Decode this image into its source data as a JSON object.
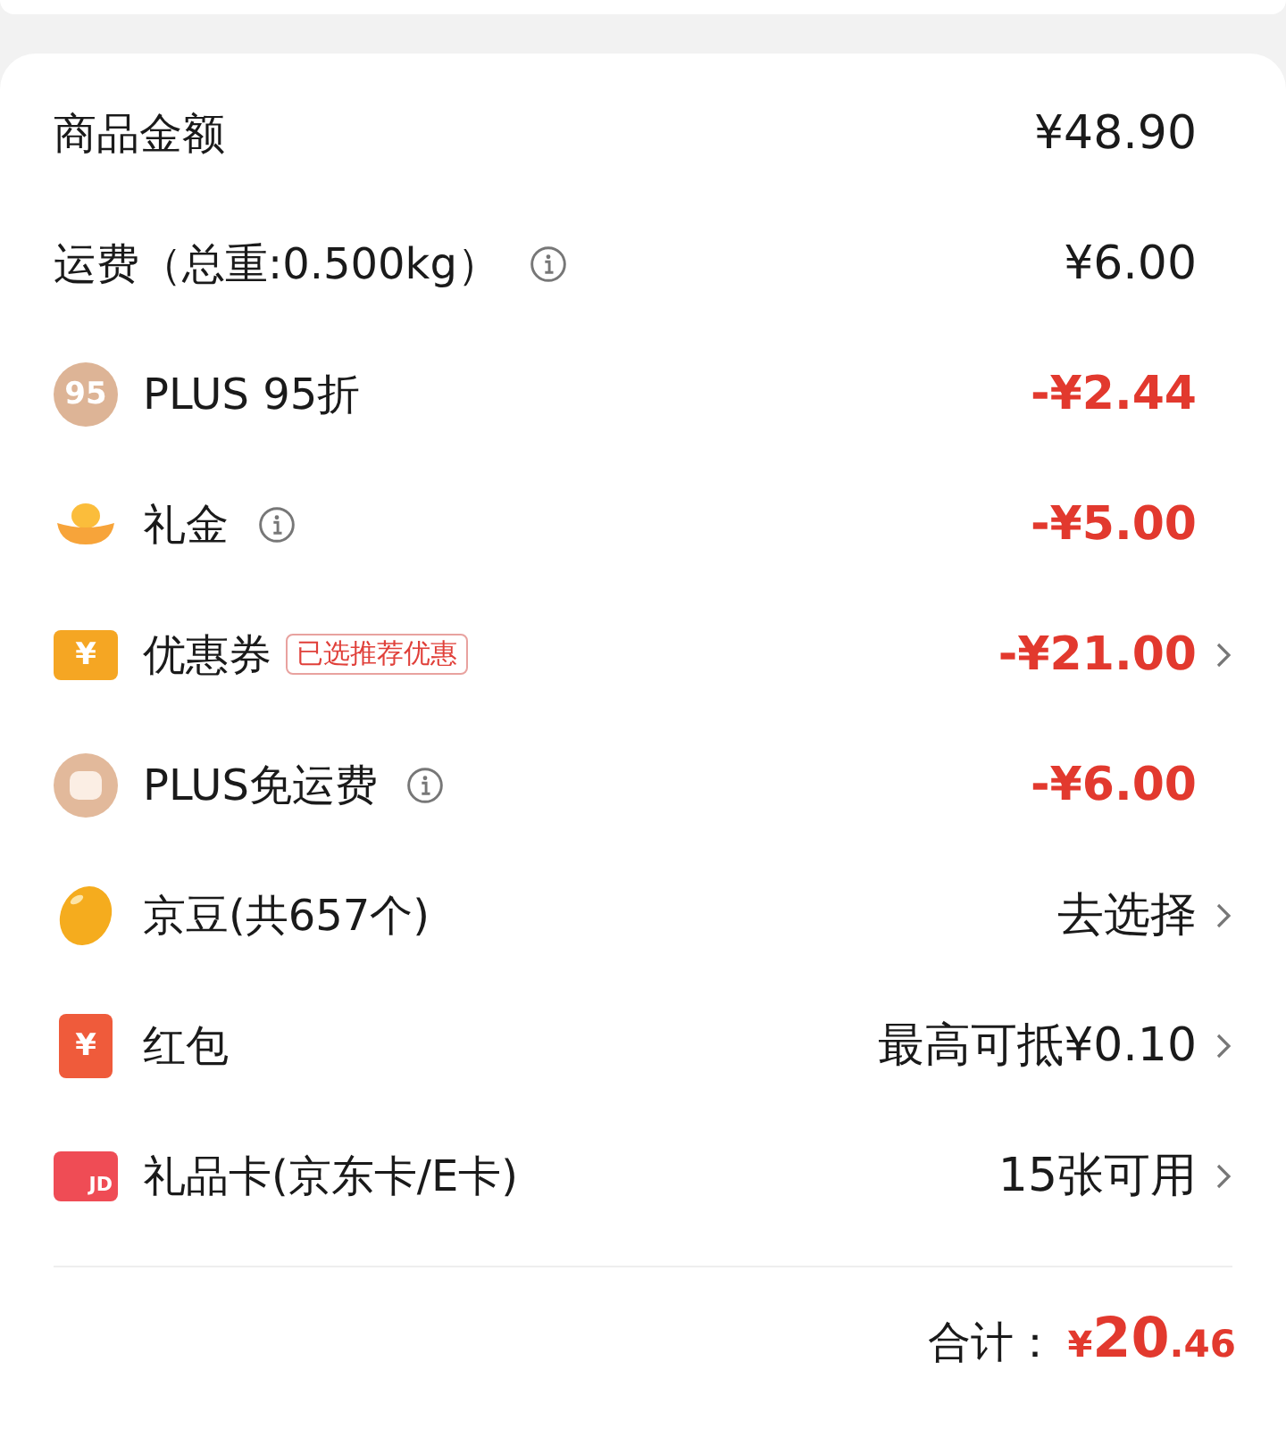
{
  "rows": [
    {
      "kind": "plain",
      "label": "商品金额",
      "info": false,
      "value": "¥48.90",
      "discount": false,
      "chevron": false
    },
    {
      "kind": "plain",
      "label": "运费（总重:0.500kg）",
      "info": true,
      "value": "¥6.00",
      "discount": false,
      "chevron": false
    },
    {
      "kind": "plus",
      "icon_text": "95",
      "label": "PLUS 95折",
      "info": false,
      "value": "-¥2.44",
      "discount": true,
      "chevron": false
    },
    {
      "kind": "ingot",
      "label": "礼金",
      "info": true,
      "value": "-¥5.00",
      "discount": true,
      "chevron": false
    },
    {
      "kind": "coupon",
      "icon_text": "¥",
      "label": "优惠券",
      "tag": "已选推荐优惠",
      "info": false,
      "value": "-¥21.00",
      "discount": true,
      "chevron": true
    },
    {
      "kind": "shipping",
      "label": "PLUS免运费",
      "info": true,
      "value": "-¥6.00",
      "discount": true,
      "chevron": false
    },
    {
      "kind": "beans",
      "label": "京豆(共657个)",
      "info": false,
      "value": "去选择",
      "discount": false,
      "chevron": true
    },
    {
      "kind": "envelope",
      "icon_text": "¥",
      "label": "红包",
      "info": false,
      "value": "最高可抵¥0.10",
      "discount": false,
      "chevron": true
    },
    {
      "kind": "giftcard",
      "icon_text": "JD",
      "label": "礼品卡(京东卡/E卡)",
      "info": false,
      "value": "15张可用",
      "discount": false,
      "chevron": true
    }
  ],
  "total": {
    "label": "合计：",
    "currency": "¥",
    "integer": "20",
    "decimal": ".46"
  }
}
